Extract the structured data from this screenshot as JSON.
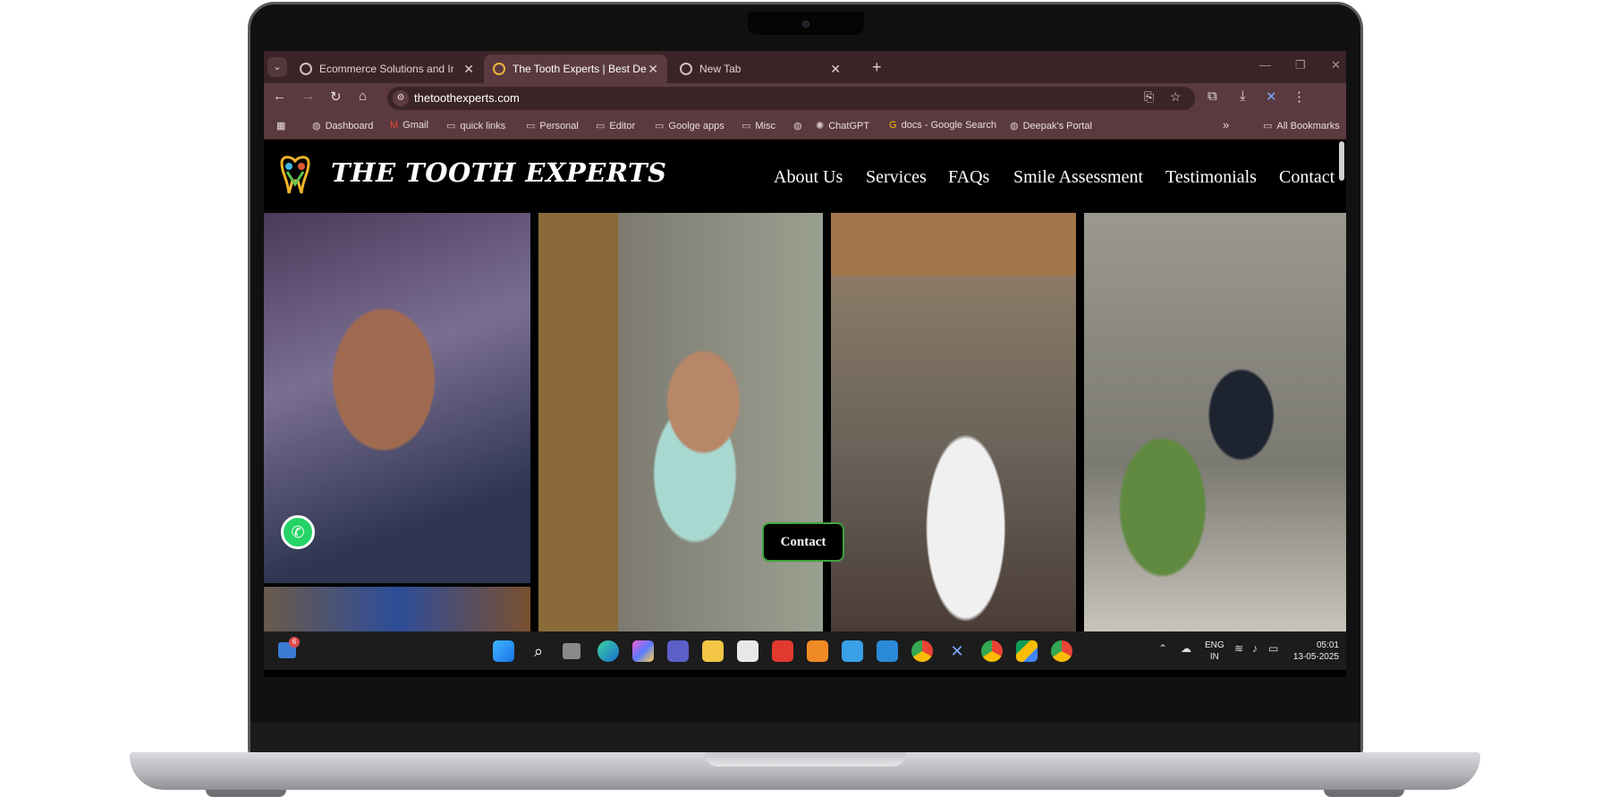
{
  "browser": {
    "tabs": [
      {
        "label": "Ecommerce Solutions and Integ",
        "active": false
      },
      {
        "label": "The Tooth Experts | Best Dental",
        "active": true
      },
      {
        "label": "New Tab",
        "active": false
      }
    ],
    "new_tab_symbol": "+",
    "url": "thetoothexperts.com",
    "bookmarks": [
      {
        "label": "Dashboard",
        "icon": "globe-icon"
      },
      {
        "label": "Gmail",
        "icon": "gmail-icon"
      },
      {
        "label": "quick links",
        "icon": "folder-icon"
      },
      {
        "label": "Personal",
        "icon": "folder-icon"
      },
      {
        "label": "Editor",
        "icon": "folder-icon"
      },
      {
        "label": "Goolge apps",
        "icon": "folder-icon"
      },
      {
        "label": "Misc",
        "icon": "folder-icon"
      },
      {
        "label": "ChatGPT",
        "icon": "chatgpt-icon"
      },
      {
        "label": "docs - Google Search",
        "icon": "google-icon"
      },
      {
        "label": "Deepak's Portal",
        "icon": "globe-icon"
      }
    ],
    "all_bookmarks": "All Bookmarks",
    "overflow_symbol": "»"
  },
  "site": {
    "brand": "THE TOOTH EXPERTS",
    "nav": [
      "About Us",
      "Services",
      "FAQs",
      "Smile Assessment",
      "Testimonials",
      "Contact"
    ],
    "contact_button": "Contact"
  },
  "taskbar": {
    "widget_badge": "6",
    "language": "ENG",
    "region": "IN",
    "time": "05:01",
    "date": "13-05-2025"
  },
  "colors": {
    "tab_strip": "#3b2428",
    "toolbar": "#5a3a3f",
    "site_background": "#000000",
    "whatsapp": "#25d366",
    "contact_border": "#3fa33f"
  }
}
